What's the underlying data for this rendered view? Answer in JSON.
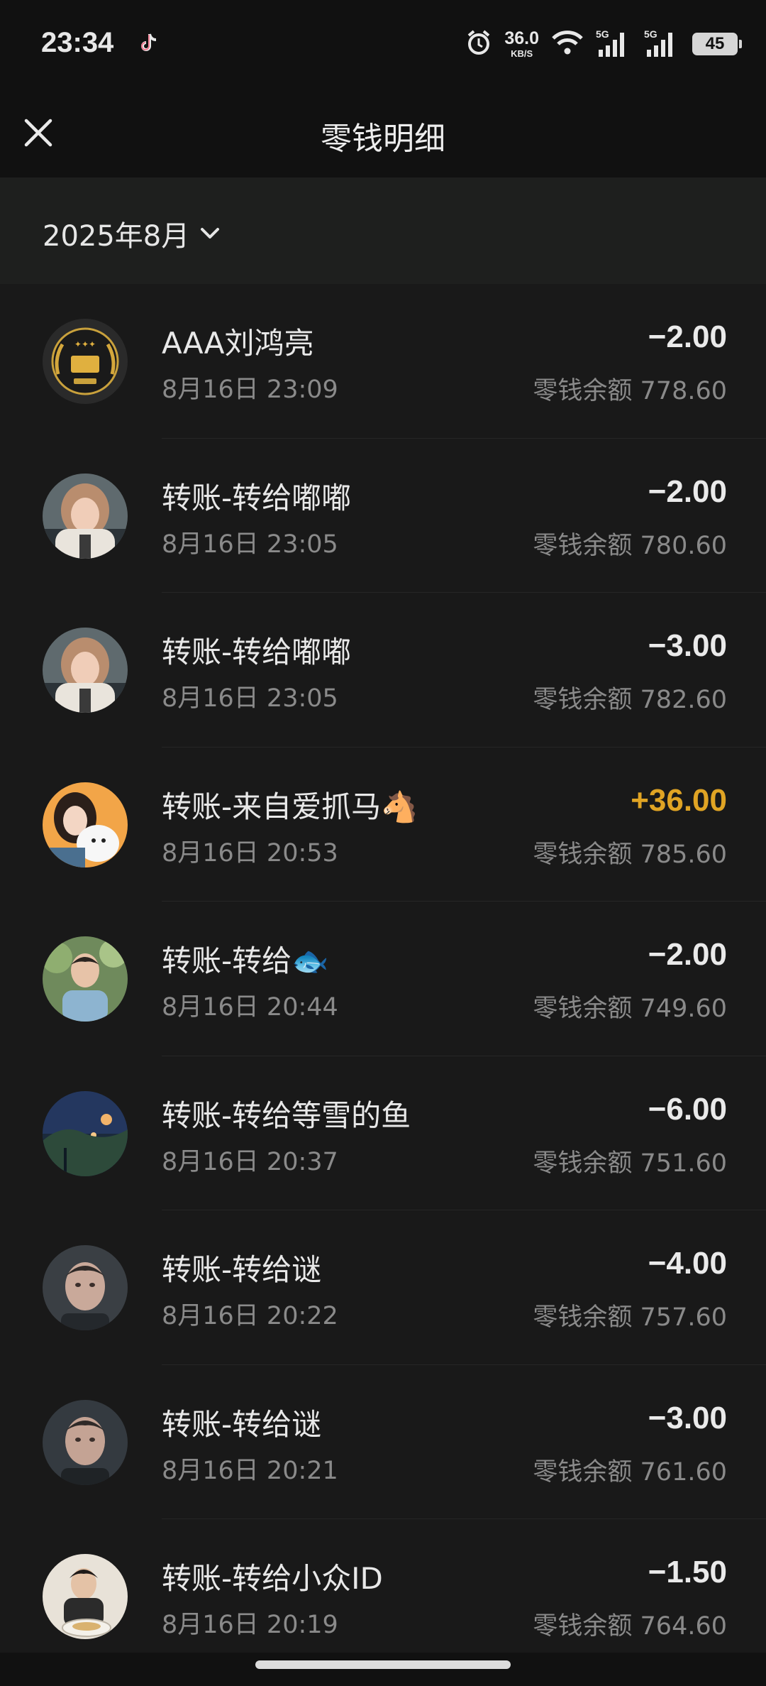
{
  "status_bar": {
    "time": "23:34",
    "tiktok_icon": "tiktok-icon",
    "net_speed_value": "36.0",
    "net_speed_unit": "KB/S",
    "signal_1_label": "5G",
    "signal_2_label": "5G",
    "battery": "45"
  },
  "nav": {
    "close_icon": "close-icon",
    "title": "零钱明细"
  },
  "filter": {
    "month": "2025年8月",
    "dropdown_icon": "chevron-down-icon"
  },
  "transactions": [
    {
      "title": "AAA刘鸿亮",
      "time": "8月16日 23:09",
      "amount": "−2.00",
      "balance": "零钱余额 778.60",
      "type": "expense"
    },
    {
      "title": "转账-转给嘟嘟",
      "time": "8月16日 23:05",
      "amount": "−2.00",
      "balance": "零钱余额 780.60",
      "type": "expense"
    },
    {
      "title": "转账-转给嘟嘟",
      "time": "8月16日 23:05",
      "amount": "−3.00",
      "balance": "零钱余额 782.60",
      "type": "expense"
    },
    {
      "title": "转账-来自爱抓马🐴",
      "time": "8月16日 20:53",
      "amount": "+36.00",
      "balance": "零钱余额 785.60",
      "type": "income"
    },
    {
      "title": "转账-转给🐟",
      "time": "8月16日 20:44",
      "amount": "−2.00",
      "balance": "零钱余额 749.60",
      "type": "expense"
    },
    {
      "title": "转账-转给等雪的鱼",
      "time": "8月16日 20:37",
      "amount": "−6.00",
      "balance": "零钱余额 751.60",
      "type": "expense"
    },
    {
      "title": "转账-转给谜",
      "time": "8月16日 20:22",
      "amount": "−4.00",
      "balance": "零钱余额 757.60",
      "type": "expense"
    },
    {
      "title": "转账-转给谜",
      "time": "8月16日 20:21",
      "amount": "−3.00",
      "balance": "零钱余额 761.60",
      "type": "expense"
    },
    {
      "title": "转账-转给小众ID",
      "time": "8月16日 20:19",
      "amount": "−1.50",
      "balance": "零钱余额 764.60",
      "type": "expense"
    }
  ],
  "colors": {
    "background": "#191919",
    "header": "#111111",
    "income": "#e0a424",
    "secondary_text": "#8a8a8a"
  }
}
